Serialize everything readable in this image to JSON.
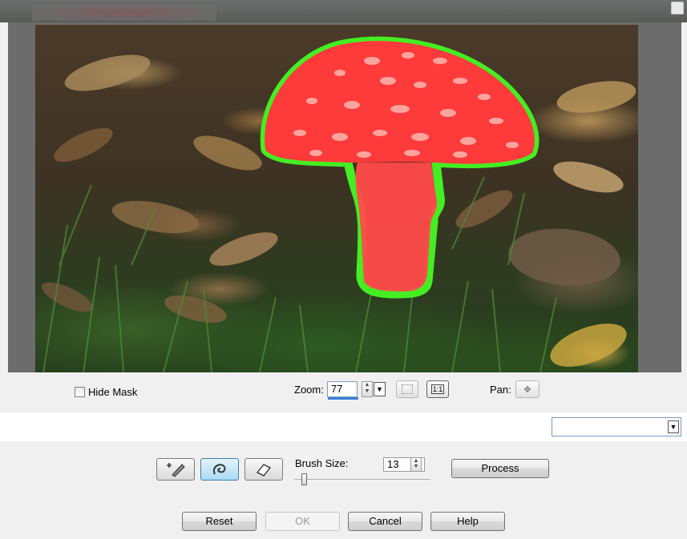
{
  "mask_options": {
    "hide_mask_label": "Hide Mask",
    "hide_mask_checked": false
  },
  "zoom": {
    "label": "Zoom:",
    "value": "77",
    "spinner_up_icon": "up-arrow-icon",
    "spinner_down_icon": "down-arrow-icon",
    "dropdown_icon": "chevron-down-icon",
    "fit_button_icon": "fit-to-window-icon",
    "actual_size_label": "1:1"
  },
  "pan": {
    "label": "Pan:",
    "icon": "move-arrows-icon"
  },
  "mode_select": {
    "value": "",
    "arrow_icon": "chevron-down-icon"
  },
  "brush": {
    "tools": [
      {
        "name": "add-brush",
        "icon": "plus-brush-icon",
        "active": false
      },
      {
        "name": "smart-brush",
        "icon": "swirl-brush-icon",
        "active": true
      },
      {
        "name": "eraser",
        "icon": "eraser-icon",
        "active": false
      }
    ],
    "size_label": "Brush Size:",
    "size_value": "13",
    "slider_level": 0.08
  },
  "buttons": {
    "process": "Process",
    "reset": "Reset",
    "ok": "OK",
    "cancel": "Cancel",
    "help": "Help"
  },
  "colors": {
    "mask_red": "#ff3a3a",
    "outline_green": "#44ee22",
    "accent_blue": "#3c7fd6"
  }
}
